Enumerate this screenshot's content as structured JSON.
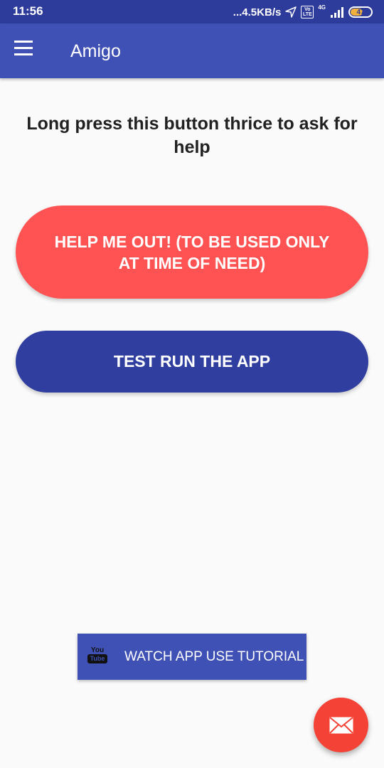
{
  "status_bar": {
    "time": "11:56",
    "network_speed": "...4.5KB/s",
    "volte": "Vo LTE",
    "network_type": "4G",
    "battery": "47"
  },
  "app_bar": {
    "title": "Amigo",
    "menu_icon": "hamburger-menu-icon"
  },
  "main": {
    "instruction": "Long press this button thrice to ask for help",
    "help_button_label": "HELP ME OUT! (TO BE USED ONLY AT TIME OF NEED)",
    "test_button_label": "TEST RUN THE APP",
    "tutorial_button_label": "WATCH APP USE TUTORIAL",
    "tutorial_icon": "youtube-icon",
    "yt_you": "You",
    "yt_tube": "Tube"
  },
  "fab": {
    "icon": "mail-icon"
  },
  "colors": {
    "primary": "#3f51b5",
    "primary_dark": "#303f9f",
    "status_bar": "#2d3b9b",
    "help_red": "#ff5252",
    "fab_red": "#f44336",
    "background": "#fafafa"
  }
}
